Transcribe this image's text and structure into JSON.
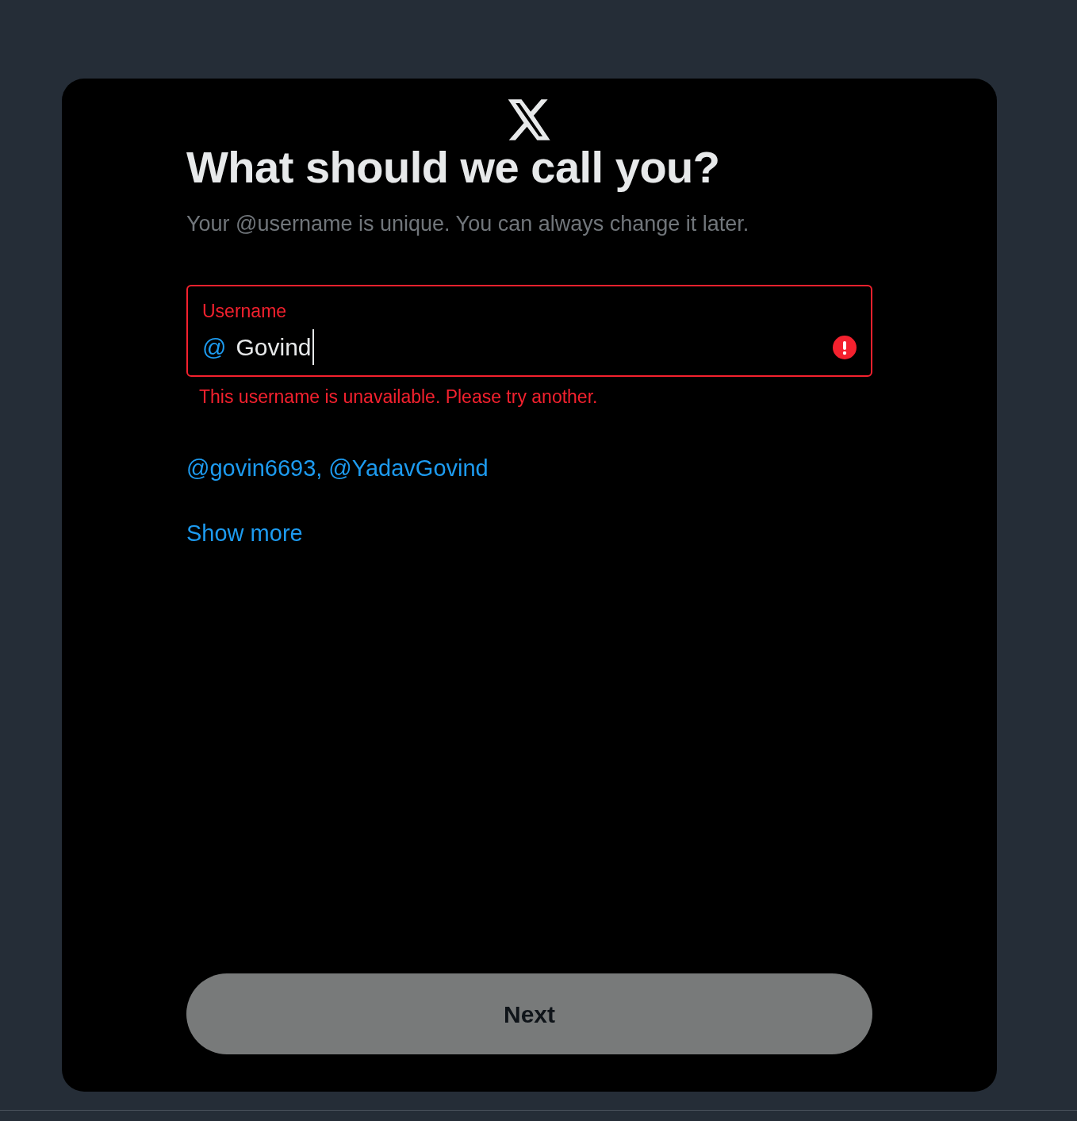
{
  "title": "What should we call you?",
  "subtitle": "Your @username is unique. You can always change it later.",
  "field": {
    "label": "Username",
    "prefix": "@",
    "value": "Govind",
    "invalid": true,
    "error": "This username is unavailable. Please try another."
  },
  "suggestions": [
    {
      "text": "@govin6693,"
    },
    {
      "text": "@YadavGovind"
    }
  ],
  "show_more": "Show more",
  "next_button": {
    "label": "Next",
    "disabled": true
  }
}
